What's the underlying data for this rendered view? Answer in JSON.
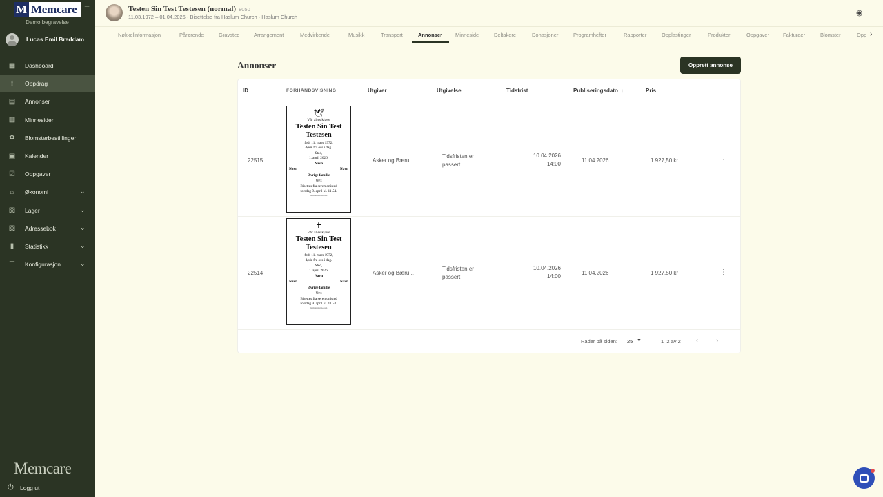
{
  "brand": {
    "logo_letter": "M",
    "logo_name": "Memcare",
    "org": "Demo begravelse",
    "footer_logo": "Memcare"
  },
  "user": {
    "name": "Lucas Emil Breddam"
  },
  "nav": [
    {
      "label": "Dashboard",
      "icon": "dashboard-icon"
    },
    {
      "label": "Oppdrag",
      "icon": "candle-icon",
      "active": true
    },
    {
      "label": "Annonser",
      "icon": "document-icon"
    },
    {
      "label": "Minnesider",
      "icon": "book-icon"
    },
    {
      "label": "Blomsterbestillinger",
      "icon": "flower-icon"
    },
    {
      "label": "Kalender",
      "icon": "calendar-icon"
    },
    {
      "label": "Oppgaver",
      "icon": "tasks-icon"
    },
    {
      "label": "Økonomi",
      "icon": "bank-icon",
      "expandable": true
    },
    {
      "label": "Lager",
      "icon": "inventory-icon",
      "expandable": true
    },
    {
      "label": "Adressebok",
      "icon": "contacts-icon",
      "expandable": true
    },
    {
      "label": "Statistikk",
      "icon": "stats-icon",
      "expandable": true
    },
    {
      "label": "Konfigurasjon",
      "icon": "settings-icon",
      "expandable": true
    }
  ],
  "logout_label": "Logg ut",
  "case": {
    "title": "Testen Sin Test Testesen (normal)",
    "id": "8050",
    "subtitle": "11.03.1972 – 01.04.2026 · Bisettelse fra Haslum Church · Haslum Church"
  },
  "tabs": [
    "Nøkkelinformasjon",
    "Pårørende",
    "Gravsted",
    "Arrangement",
    "Medvirkende",
    "Musikk",
    "Transport",
    "Annonser",
    "Minneside",
    "Deltakere",
    "Donasjoner",
    "Programhefter",
    "Rapporter",
    "Opplastinger",
    "Produkter",
    "Oppgaver",
    "Fakturaer",
    "Blomster",
    "Opp"
  ],
  "active_tab": "Annonser",
  "page": {
    "heading": "Annonser",
    "create_button": "Opprett annonse"
  },
  "table": {
    "headers": {
      "id": "ID",
      "preview": "FORHÅNDSVISNING",
      "publisher": "Utgiver",
      "issue": "Utgivelse",
      "deadline": "Tidsfrist",
      "pubdate": "Publiseringsdato",
      "price": "Pris"
    },
    "rows": [
      {
        "id": "22515",
        "publisher": "Asker og Bæru...",
        "issue": "Tidsfristen er passert",
        "deadline_date": "10.04.2026",
        "deadline_time": "14:00",
        "pubdate": "11.04.2026",
        "price": "1 927,50 kr",
        "obit": {
          "symbol": "🕊",
          "intro": "Vår alles kjære",
          "name_line1": "Testen Sin Test",
          "name_line2": "Testesen",
          "born": "født 11. mars 1972,",
          "died": "døde fra oss i dag.",
          "place": "Sted,",
          "date": "1. april 2026.",
          "navn_center": "Navn",
          "navn_left": "Navn",
          "navn_right": "Navn",
          "family": "Øvrige familie",
          "verse": "Vers",
          "cer1": "Bisettes fra seremonisted",
          "cer2": "torsdag 9. april kl. 11.54.",
          "site": "domenenavn.com"
        }
      },
      {
        "id": "22514",
        "publisher": "Asker og Bæru...",
        "issue": "Tidsfristen er passert",
        "deadline_date": "10.04.2026",
        "deadline_time": "14:00",
        "pubdate": "11.04.2026",
        "price": "1 927,50 kr",
        "obit": {
          "symbol": "✝",
          "intro": "Vår alles kjære",
          "name_line1": "Testen Sin Test",
          "name_line2": "Testesen",
          "born": "født 11. mars 1972,",
          "died": "døde fra oss i dag.",
          "place": "Sted,",
          "date": "1. april 2026.",
          "navn_center": "Navn",
          "navn_left": "Navn",
          "navn_right": "Navn",
          "family": "Øvrige familie",
          "verse": "Vers",
          "cer1": "Bisettes fra seremonisted",
          "cer2": "torsdag 9. april kl. 11.53.",
          "site": "domenenavn.com"
        }
      }
    ],
    "pagination": {
      "rows_label": "Rader på siden:",
      "rows_value": "25",
      "range": "1–2 av 2"
    }
  }
}
